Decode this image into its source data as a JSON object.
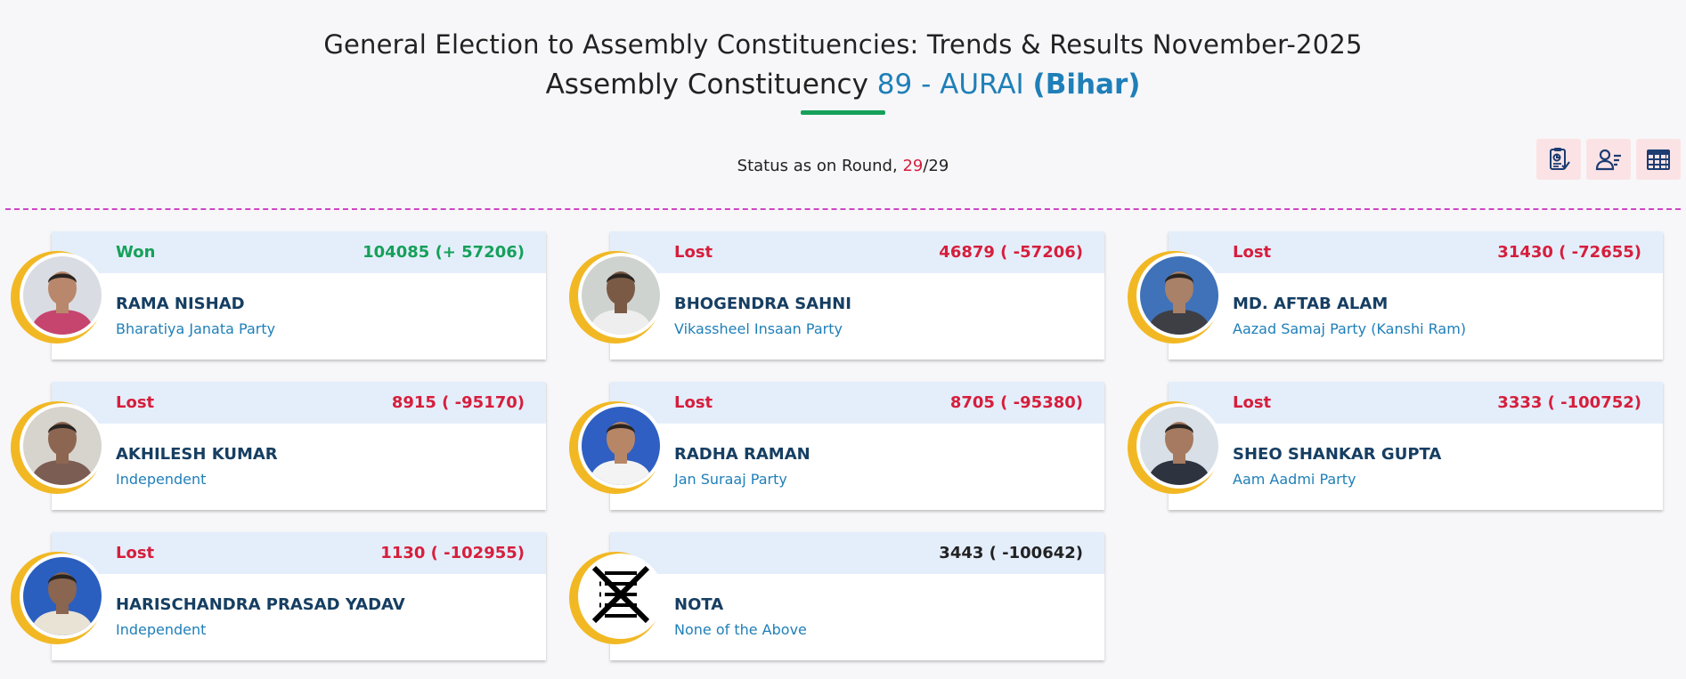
{
  "header": {
    "title_line1": "General Election to Assembly Constituencies: Trends & Results November-2025",
    "title_line2_prefix": "Assembly Constituency",
    "constituency": "89 - AURAI",
    "state": "(Bihar)"
  },
  "status": {
    "label": "Status as on Round,",
    "current_round": "29",
    "separator": "/",
    "total_rounds": "29"
  },
  "toolbar": {
    "icons": [
      "report-icon",
      "candidate-list-icon",
      "table-icon"
    ]
  },
  "colors": {
    "won": "#16a05a",
    "lost": "#d61e3c",
    "accent_blue": "#1f7fb8",
    "name_navy": "#163e62",
    "divider": "#cf45c3",
    "avatar_ring": "#f2b824",
    "card_top": "#e4eefb",
    "toolbar_bg": "#fbe3e5"
  },
  "candidates": [
    {
      "status": "Won",
      "votes": "104085 (+ 57206)",
      "name": "RAMA NISHAD",
      "party": "Bharatiya Janata Party",
      "photo": "candidate-photo",
      "bg": "#d9dde3",
      "shirt": "#c6456f",
      "skin": "#b9876b"
    },
    {
      "status": "Lost",
      "votes": "46879 ( -57206)",
      "name": "BHOGENDRA SAHNI",
      "party": "Vikassheel Insaan Party",
      "photo": "candidate-photo",
      "bg": "#cfd3d0",
      "shirt": "#eeeeee",
      "skin": "#7a5a45"
    },
    {
      "status": "Lost",
      "votes": "31430 ( -72655)",
      "name": "MD. AFTAB ALAM",
      "party": "Aazad Samaj Party (Kanshi Ram)",
      "photo": "candidate-photo",
      "bg": "#3f72b8",
      "shirt": "#3e3f45",
      "skin": "#a98068"
    },
    {
      "status": "Lost",
      "votes": "8915 ( -95170)",
      "name": "AKHILESH KUMAR",
      "party": "Independent",
      "photo": "candidate-photo",
      "bg": "#d7d3cd",
      "shirt": "#7b5d53",
      "skin": "#8d6651"
    },
    {
      "status": "Lost",
      "votes": "8705 ( -95380)",
      "name": "RADHA RAMAN",
      "party": "Jan Suraaj Party",
      "photo": "candidate-photo",
      "bg": "#2f5fc2",
      "shirt": "#f3f3f3",
      "skin": "#b78666"
    },
    {
      "status": "Lost",
      "votes": "3333 ( -100752)",
      "name": "SHEO SHANKAR GUPTA",
      "party": "Aam Aadmi Party",
      "photo": "candidate-photo",
      "bg": "#d9dfe6",
      "shirt": "#2e3340",
      "skin": "#a57a60"
    },
    {
      "status": "Lost",
      "votes": "1130 ( -102955)",
      "name": "HARISCHANDRA PRASAD YADAV",
      "party": "Independent",
      "photo": "candidate-photo",
      "bg": "#2a5fc0",
      "shirt": "#e9e3d6",
      "skin": "#8a6550"
    },
    {
      "status": "",
      "votes": "3443 ( -100642)",
      "name": "NOTA",
      "party": "None of the Above",
      "photo": "nota-symbol",
      "bg": "#ffffff",
      "shirt": "#000000",
      "skin": "#000000"
    }
  ]
}
